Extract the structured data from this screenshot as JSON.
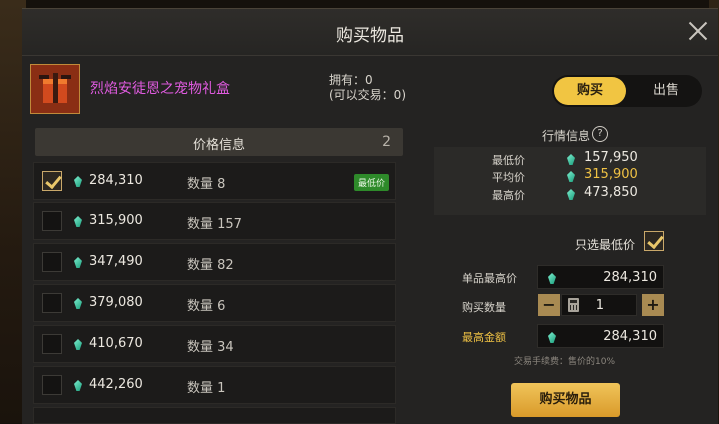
{
  "dialog": {
    "title": "购买物品"
  },
  "item": {
    "name": "烈焰安徒恩之宠物礼盒",
    "owned_line1": "拥有：0",
    "owned_line2": "(可以交易：0)"
  },
  "mode_toggle": {
    "buy_label": "购买",
    "sell_label": "出售",
    "selected": "购买"
  },
  "price_list": {
    "header": "价格信息",
    "count": "2",
    "lowest_badge": "最低价",
    "rows": [
      {
        "price": "284,310",
        "qty": "数量 8",
        "checked": true
      },
      {
        "price": "315,900",
        "qty": "数量 157",
        "checked": false
      },
      {
        "price": "347,490",
        "qty": "数量 82",
        "checked": false
      },
      {
        "price": "379,080",
        "qty": "数量 6",
        "checked": false
      },
      {
        "price": "410,670",
        "qty": "数量 34",
        "checked": false
      },
      {
        "price": "442,260",
        "qty": "数量 1",
        "checked": false
      }
    ]
  },
  "market": {
    "title": "行情信息",
    "help_icon": "?",
    "min_label": "最低价",
    "min_value": "157,950",
    "avg_label": "平均价",
    "avg_value": "315,900",
    "max_label": "最高价",
    "max_value": "473,850"
  },
  "form": {
    "only_lowest_label": "只选最低价",
    "only_lowest_checked": true,
    "unit_max_label": "单品最高价",
    "unit_max_value": "284,310",
    "quantity_label": "购买数量",
    "quantity_value": "1",
    "minus": "−",
    "plus": "+",
    "total_max_label": "最高金额",
    "total_max_value": "284,310",
    "fee_text": "交易手续费：售价的10%"
  },
  "buy_button": {
    "label": "购买物品"
  },
  "colors": {
    "accent": "#f1c542",
    "item_name": "#e05be0",
    "lowest_badge": "#2e8a2a",
    "avg_price": "#f0c244"
  }
}
